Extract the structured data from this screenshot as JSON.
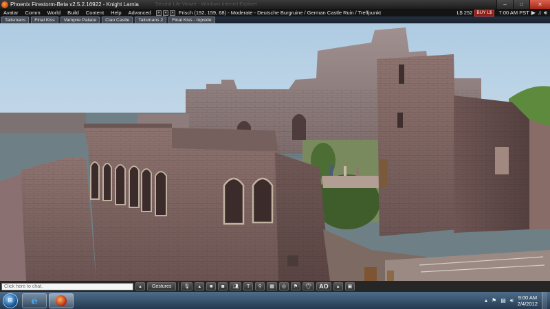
{
  "window": {
    "title": "Phoenix Firestorm-Beta v2.5.2.16922 - Knight Larnia",
    "ghost_title": "Second Life Viewer - Windows Internet Explorer",
    "controls": {
      "minimize": "–",
      "maximize": "□",
      "close": "✕"
    }
  },
  "menubar": {
    "items": [
      "Avatar",
      "Comm",
      "World",
      "Build",
      "Content",
      "Help",
      "Advanced"
    ],
    "location": "Frisch (192, 159, 68) - Moderate - Deutsche Burgruine / German Castle Ruin / Treffpunkt",
    "balance": "L$ 252",
    "buy_label": "BUY L$",
    "time": "7:00 AM PST",
    "icons": [
      "media-icon",
      "music-icon",
      "volume-icon"
    ]
  },
  "favorites": [
    "Talismans",
    "Final Kiss",
    "Vampire Palace",
    "Clan Castle",
    "Talismans 2",
    "Final Kiss - topside"
  ],
  "toolbar": {
    "chat_placeholder": "Click here to chat.",
    "gestures_label": "Gestures",
    "ao_label": "AO",
    "buttons": [
      {
        "name": "speak-button",
        "icon": "microphone-icon"
      },
      {
        "name": "camera-button",
        "icon": "camera-icon"
      },
      {
        "name": "snapshot-button",
        "icon": "snapshot-icon"
      },
      {
        "name": "people-button",
        "icon": "people-icon"
      },
      {
        "name": "build-button",
        "icon": "hammer-icon"
      },
      {
        "name": "search-button",
        "icon": "search-icon"
      },
      {
        "name": "map-button",
        "icon": "map-icon"
      },
      {
        "name": "minimap-button",
        "icon": "minimap-icon"
      },
      {
        "name": "places-button",
        "icon": "places-icon"
      },
      {
        "name": "appearance-button",
        "icon": "shirt-icon"
      },
      {
        "name": "inventory-button",
        "icon": "inventory-icon"
      }
    ]
  },
  "taskbar": {
    "time": "9:00 AM",
    "date": "2/4/2012",
    "apps": [
      "internet-explorer",
      "firestorm-viewer"
    ]
  },
  "scene": {
    "description_colors": {
      "sky_top": "#b9d4e7",
      "sky_bottom": "#e7eef3",
      "stone": "#8a6f6b",
      "stone_dark": "#5f4a48",
      "grass": "#5d7a3a"
    }
  }
}
